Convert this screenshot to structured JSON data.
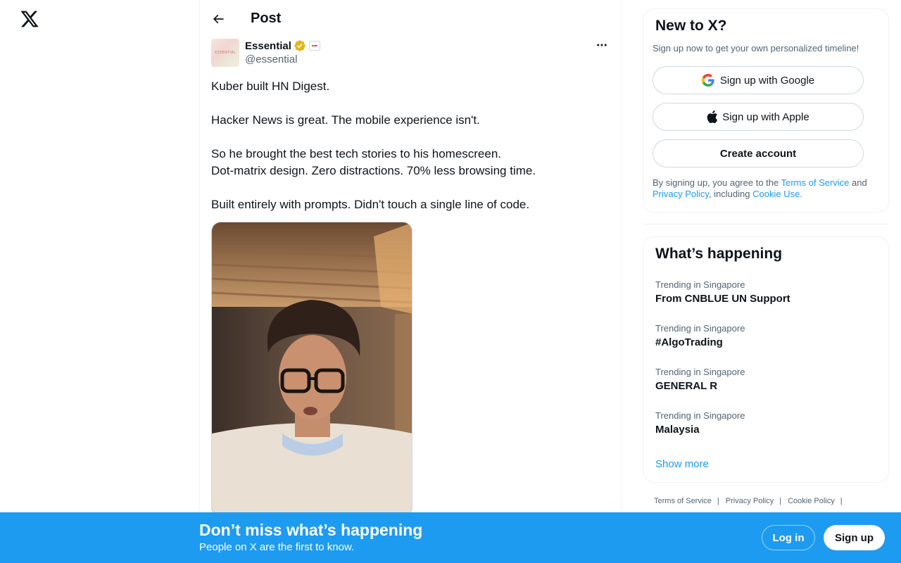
{
  "nav": {
    "logo_icon": "x-logo-icon"
  },
  "post_header": {
    "back_icon": "arrow-left-icon",
    "title": "Post"
  },
  "author": {
    "avatar_text": "ESSENTIAL",
    "name": "Essential",
    "verified_icon": "gold-verified-badge-icon",
    "affiliate_icon": "affiliate-badge-icon",
    "handle": "@essential",
    "more_icon": "more-horizontal-icon"
  },
  "post": {
    "paragraphs": [
      "Kuber built HN Digest.",
      "",
      "Hacker News is great. The mobile experience isn't.",
      "",
      "So he brought the best tech stories to his homescreen.",
      "Dot-matrix design. Zero distractions. 70% less browsing time.",
      "",
      "Built entirely with prompts. Didn't touch a single line of code."
    ],
    "media": "video-thumbnail-person-with-glasses"
  },
  "signup_card": {
    "title": "New to X?",
    "subtitle": "Sign up now to get your own personalized timeline!",
    "google_label": "Sign up with Google",
    "apple_label": "Sign up with Apple",
    "create_label": "Create account",
    "legal_prefix": "By signing up, you agree to the ",
    "terms_link": "Terms of Service",
    "legal_and": " and",
    "privacy_link": "Privacy Policy",
    "legal_including": ", including ",
    "cookie_link": "Cookie Use."
  },
  "trends": {
    "title": "What’s happening",
    "items": [
      {
        "meta": "Trending in Singapore",
        "name": "From CNBLUE UN Support"
      },
      {
        "meta": "Trending in Singapore",
        "name": "#AlgoTrading"
      },
      {
        "meta": "Trending in Singapore",
        "name": "GENERAL R"
      },
      {
        "meta": "Trending in Singapore",
        "name": "Malaysia"
      }
    ],
    "show_more": "Show more"
  },
  "footer": {
    "links": [
      "Terms of Service",
      "Privacy Policy",
      "Cookie Policy"
    ],
    "separator": "|"
  },
  "banner": {
    "title": "Don’t miss what’s happening",
    "subtitle": "People on X are the first to know.",
    "login_label": "Log in",
    "signup_label": "Sign up"
  },
  "colors": {
    "accent": "#1d9bf0",
    "text_primary": "#0f1419",
    "text_secondary": "#536471",
    "border": "#eff3f4"
  }
}
